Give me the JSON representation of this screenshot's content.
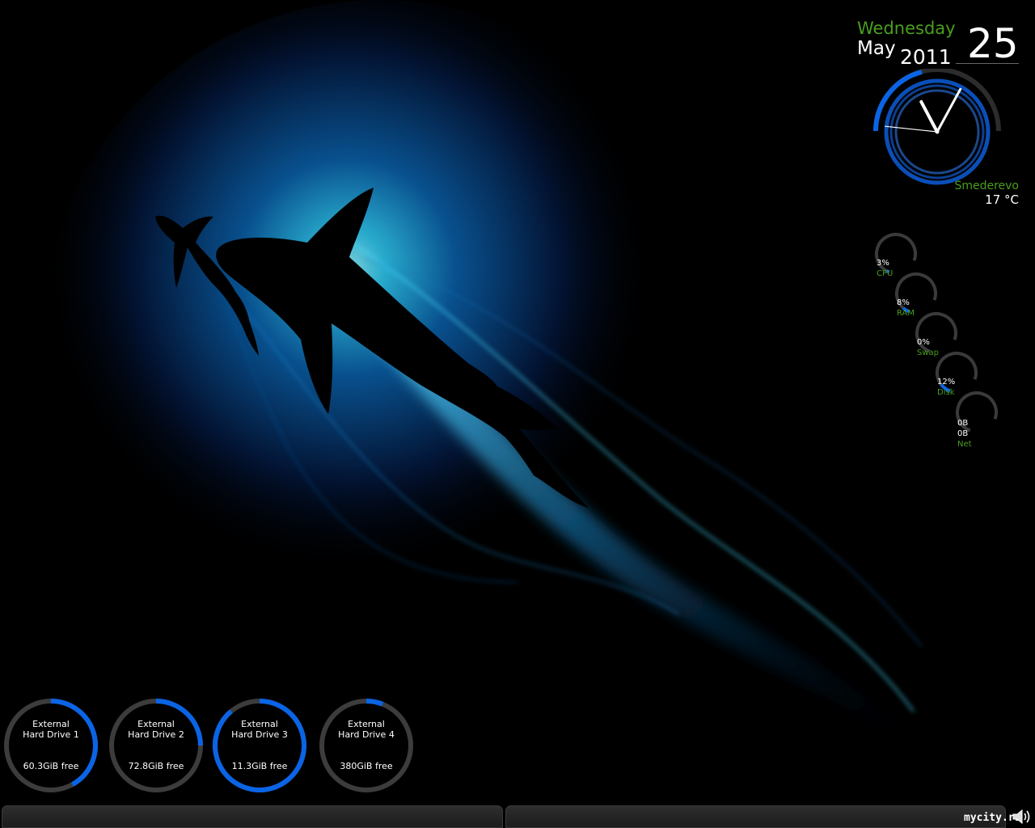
{
  "date": {
    "weekday": "Wednesday",
    "month": "May",
    "year": "2011",
    "day": "25"
  },
  "weather": {
    "city": "Smederevo",
    "temperature": "17 °C"
  },
  "clock": {
    "hour": 11,
    "minute": 4,
    "second": 46
  },
  "system_monitor": [
    {
      "value": "3%",
      "label": "CPU",
      "level": 0.03
    },
    {
      "value": "8%",
      "label": "RAM",
      "level": 0.08
    },
    {
      "value": "0%",
      "label": "Swap",
      "level": 0.0
    },
    {
      "value": "12%",
      "label": "Disk",
      "level": 0.12
    },
    {
      "value": "0B",
      "value2": "0B",
      "label": "Net",
      "level": 0.0
    }
  ],
  "drives": [
    {
      "line1": "External",
      "line2": "Hard Drive 1",
      "free": "60.3GiB free",
      "used_fraction": 0.42
    },
    {
      "line1": "External",
      "line2": "Hard Drive 2",
      "free": "72.8GiB free",
      "used_fraction": 0.25
    },
    {
      "line1": "External",
      "line2": "Hard Drive 3",
      "free": "11.3GiB free",
      "used_fraction": 0.89
    },
    {
      "line1": "External",
      "line2": "Hard Drive 4",
      "free": "380GiB free",
      "used_fraction": 0.06
    }
  ],
  "taskbar": {
    "brand": "mycity.rs"
  },
  "icons": {
    "volume": "speaker-icon"
  },
  "colors": {
    "accent_blue": "#0a64e6",
    "track_gray": "#3c3c3c",
    "label_green": "#4a9e1e",
    "glow_cyan": "#3fd6ff"
  }
}
